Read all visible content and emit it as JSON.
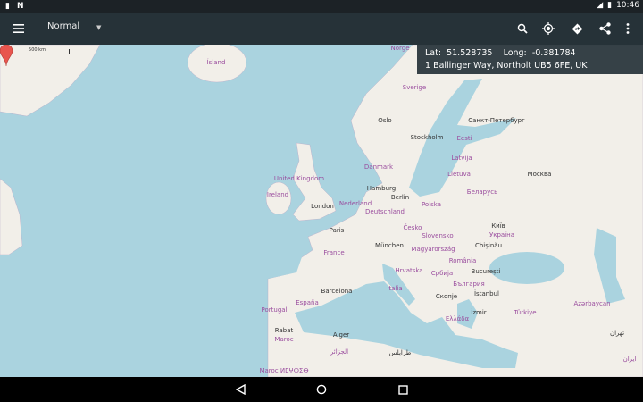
{
  "status_bar": {
    "time": "10:46",
    "icons": [
      "sim-card-icon",
      "n-notification-icon",
      "signal-icon",
      "battery-icon"
    ]
  },
  "toolbar": {
    "menu_icon": "hamburger-menu-icon",
    "map_mode": "Normal",
    "actions": [
      "search-icon",
      "my-location-icon",
      "directions-icon",
      "share-icon",
      "more-vert-icon"
    ]
  },
  "scale_bar": {
    "label": "500 km"
  },
  "info": {
    "lat_label": "Lat:",
    "lat": "51.528735",
    "long_label": "Long:",
    "long": "-0.381784",
    "address": "1 Ballinger Way, Northolt UB5 6FE, UK"
  },
  "marker": {
    "color": "#e8554e",
    "city": "London"
  },
  "map": {
    "water_color": "#aad3df",
    "land_color": "#f2efe9",
    "labels": [
      "Ísland",
      "Norge",
      "Sverige",
      "Oslo",
      "Stockholm",
      "Санкт-Петербург",
      "Eesti",
      "Latvija",
      "Lietuva",
      "Danmark",
      "United Kingdom",
      "Ireland",
      "London",
      "Hamburg",
      "Berlin",
      "Nederland",
      "Deutschland",
      "Polska",
      "Беларусь",
      "Москва",
      "Київ",
      "Україна",
      "Česko",
      "Slovensko",
      "München",
      "Paris",
      "France",
      "Magyarország",
      "Chișinău",
      "România",
      "Hrvatska",
      "Србија",
      "București",
      "България",
      "Italia",
      "Скопје",
      "İstanbul",
      "Barcelona",
      "España",
      "Portugal",
      "Türkiye",
      "Ελλάδα",
      "İzmir",
      "Alger",
      "Rabat",
      "Maroc",
      "Azərbaycan",
      "تهران",
      "ایران",
      "طرابلس",
      "الجزائر",
      "Maroc ⵍⵎⵖⵔⵉⴱ"
    ]
  },
  "nav_bar": {
    "buttons": [
      "back-icon",
      "home-icon",
      "recents-icon"
    ]
  }
}
